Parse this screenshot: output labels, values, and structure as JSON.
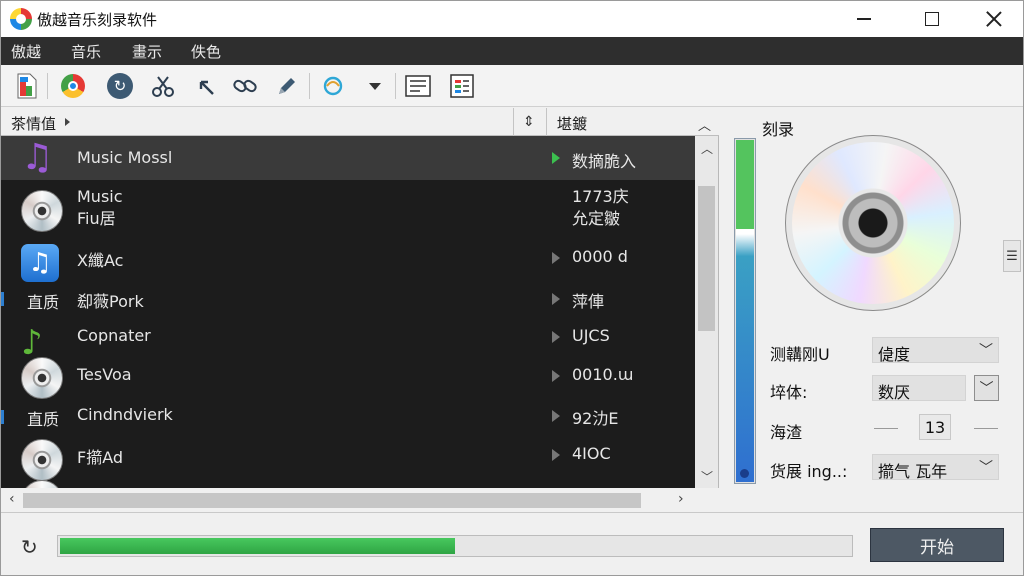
{
  "window": {
    "title": "傲越音乐刻录软件",
    "controls": {
      "minimize": "minimize",
      "maximize": "maximize",
      "close": "close"
    }
  },
  "menu": [
    "傲越",
    "音乐",
    "畫示",
    "佚色"
  ],
  "toolbar": {
    "icons": [
      "add-file-icon",
      "chrome-icon",
      "refresh-icon",
      "cut-icon",
      "back-arrow-icon",
      "link-icon",
      "pen-icon",
      "sync-icon",
      "dropdown-icon",
      "list-view-icon",
      "details-view-icon"
    ]
  },
  "file_list": {
    "columns": {
      "name": "茶情值",
      "sort_icon": "⇕",
      "status": "堪鍍"
    },
    "rows": [
      {
        "icon": "music-note-purple",
        "prefix": "",
        "name": "Music Mossl",
        "status": "数摘脆入",
        "status_marker": "green"
      },
      {
        "icon": "cd-disc",
        "prefix": "",
        "name": "Music\nFiu居",
        "status": "1773庆\n允定皺",
        "status_marker": "none"
      },
      {
        "icon": "music-note-tile",
        "prefix": "",
        "name": "X纖Ac",
        "status": "0000 d",
        "status_marker": "gray"
      },
      {
        "icon": "none",
        "prefix": "直质",
        "name": "㕁薇Pork",
        "status": "萍俥",
        "status_marker": "gray"
      },
      {
        "icon": "music-note-green",
        "prefix": "",
        "name": "Copnater",
        "status": "UJCS",
        "status_marker": "gray"
      },
      {
        "icon": "cd-disc",
        "prefix": "",
        "name": "TesVoa",
        "status": "0010.ɯ",
        "status_marker": "gray"
      },
      {
        "icon": "none",
        "prefix": "直质",
        "name": "Cindndvierk",
        "status": "92氻E",
        "status_marker": "gray"
      },
      {
        "icon": "cd-disc",
        "prefix": "",
        "name": "F擶Ad",
        "status": "4IOC",
        "status_marker": "gray"
      },
      {
        "icon": "cd-disc",
        "prefix": "",
        "name": "",
        "status": "",
        "status_marker": "none"
      }
    ]
  },
  "burn_panel": {
    "title": "刻录",
    "level_meter": {
      "value": 1.0,
      "green_fraction": 0.26
    },
    "options": [
      {
        "label": "测韝刚U",
        "value": "偼度"
      },
      {
        "label": "埣体:",
        "value": "数厌"
      },
      {
        "label": "海渣",
        "value": "13"
      },
      {
        "label": "货展  ing..:",
        "value": "擶气 瓦年"
      }
    ]
  },
  "footer": {
    "progress": 0.5,
    "start_button": "开始"
  },
  "colors": {
    "menubar_bg": "#2e2e2e",
    "list_bg": "#1c1c1c",
    "selected_row": "#3a3a3a",
    "progress_green": "#3cbf4f",
    "start_button_bg": "#4d5864"
  }
}
